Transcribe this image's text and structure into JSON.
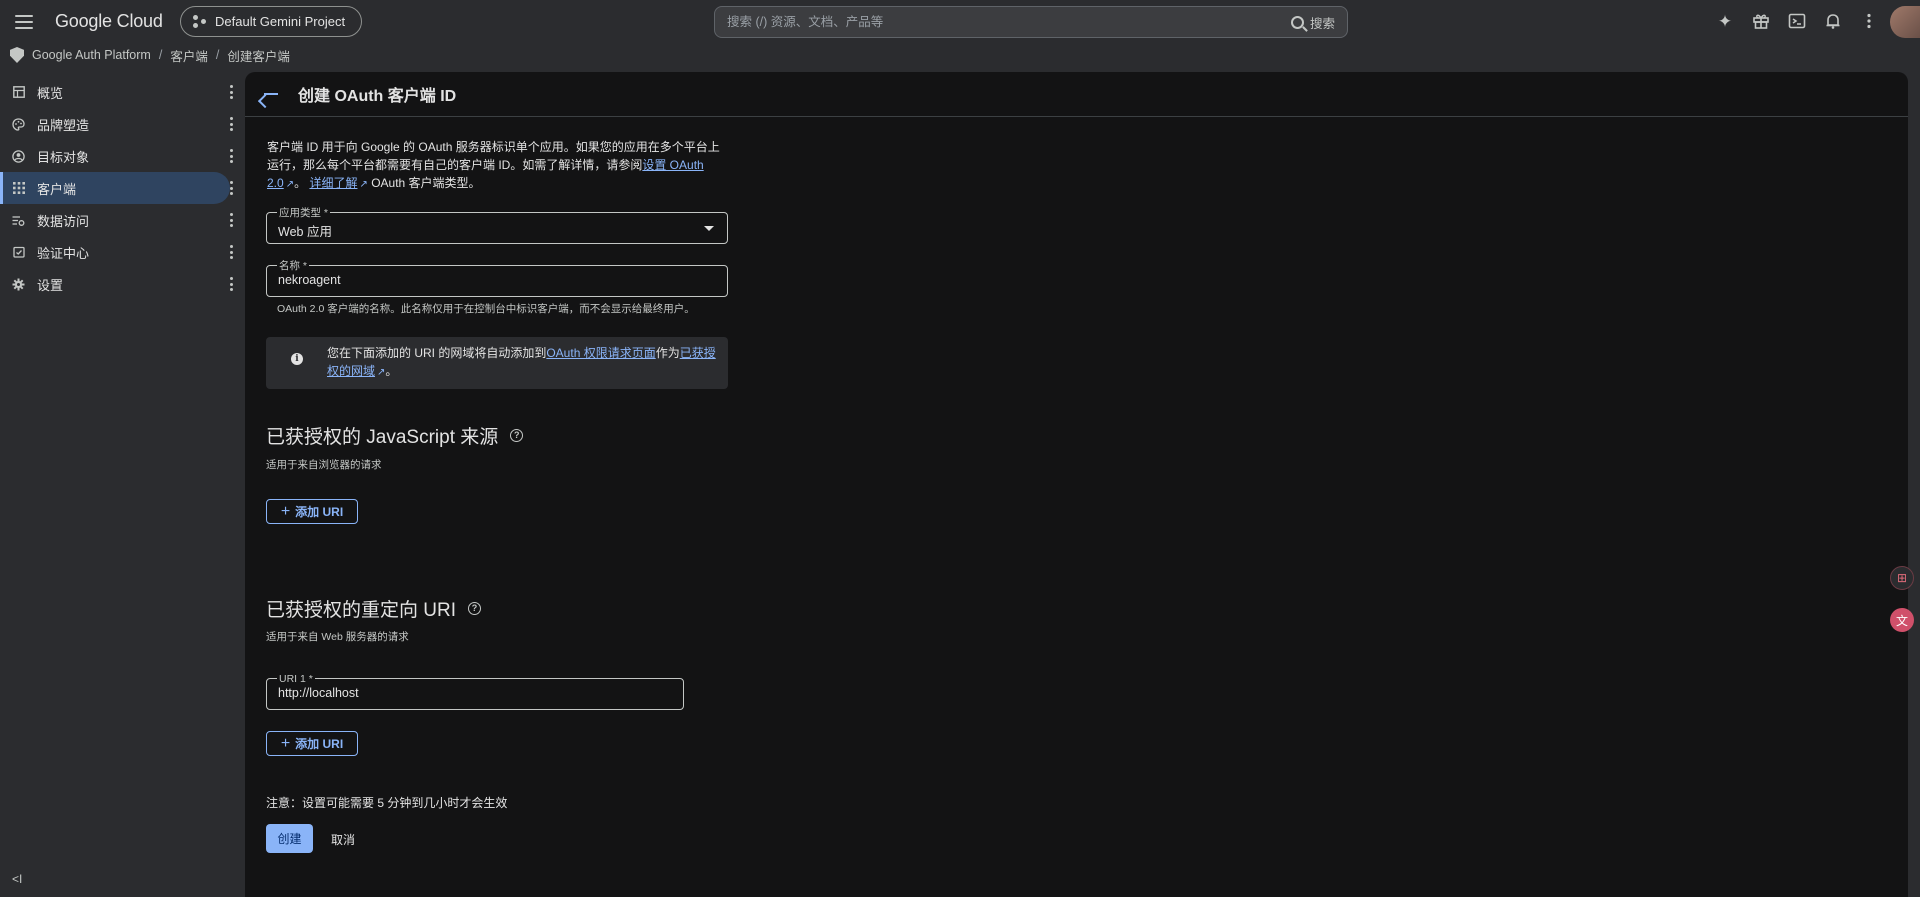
{
  "topbar": {
    "logo": "Google Cloud",
    "project": "Default Gemini Project",
    "search_placeholder": "搜索 (/) 资源、文档、产品等",
    "search_button": "搜索"
  },
  "breadcrumb": {
    "items": [
      "Google Auth Platform",
      "客户端",
      "创建客户端"
    ]
  },
  "sidebar": {
    "items": [
      {
        "label": "概览",
        "icon": "dashboard-icon"
      },
      {
        "label": "品牌塑造",
        "icon": "palette-icon"
      },
      {
        "label": "目标对象",
        "icon": "account-circle-icon"
      },
      {
        "label": "客户端",
        "icon": "apps-grid-icon",
        "active": true
      },
      {
        "label": "数据访问",
        "icon": "data-settings-icon"
      },
      {
        "label": "验证中心",
        "icon": "verified-icon"
      },
      {
        "label": "设置",
        "icon": "gear-icon"
      }
    ]
  },
  "page": {
    "title": "创建 OAuth 客户端 ID",
    "intro_text": "客户端 ID 用于向 Google 的 OAuth 服务器标识单个应用。如果您的应用在多个平台上运行，那么每个平台都需要有自己的客户端 ID。如需了解详情，请参阅",
    "intro_link1": "设置 OAuth 2.0",
    "intro_sep": "。",
    "intro_link2": "详细了解",
    "intro_tail": "OAuth 客户端类型。",
    "app_type_label": "应用类型 *",
    "app_type_value": "Web 应用",
    "name_label": "名称 *",
    "name_value": "nekroagent",
    "name_hint": "OAuth 2.0 客户端的名称。此名称仅用于在控制台中标识客户端，而不会显示给最终用户。",
    "info_text": "您在下面添加的 URI 的网域将自动添加到",
    "info_link1": "OAuth 权限请求页面",
    "info_mid": "作为",
    "info_link2": "已获授权的网域",
    "info_end": "。",
    "js_origins_title": "已获授权的 JavaScript 来源",
    "js_origins_sub": "适用于来自浏览器的请求",
    "add_uri_label": "添加 URI",
    "redirect_title": "已获授权的重定向 URI",
    "redirect_sub": "适用于来自 Web 服务器的请求",
    "uri1_label": "URI 1 *",
    "uri1_value": "http://localhost",
    "note": "注意：设置可能需要 5 分钟到几小时才会生效",
    "create_label": "创建",
    "cancel_label": "取消"
  },
  "colors": {
    "accent": "#8ab4f8",
    "background": "#131314",
    "chrome": "#2b2c2f",
    "active_nav": "#2f4460"
  }
}
